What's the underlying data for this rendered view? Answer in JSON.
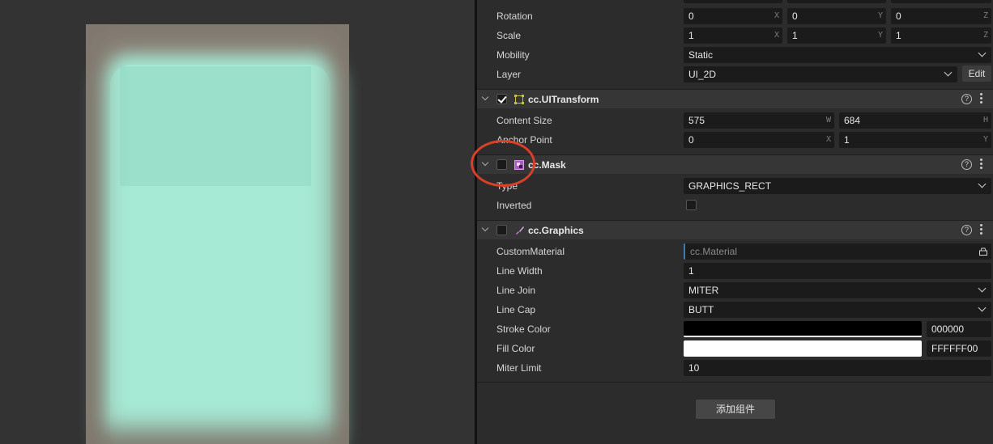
{
  "transform": {
    "rotation": {
      "label": "Rotation",
      "x": "0",
      "y": "0",
      "z": "0"
    },
    "scale": {
      "label": "Scale",
      "x": "1",
      "y": "1",
      "z": "1"
    },
    "mobility": {
      "label": "Mobility",
      "value": "Static"
    },
    "layer": {
      "label": "Layer",
      "value": "UI_2D",
      "edit_label": "Edit"
    }
  },
  "axis_labels": {
    "x": "X",
    "y": "Y",
    "z": "Z",
    "w": "W",
    "h": "H"
  },
  "ui_transform": {
    "title": "cc.UITransform",
    "content_size": {
      "label": "Content Size",
      "w": "575",
      "h": "684"
    },
    "anchor_point": {
      "label": "Anchor Point",
      "x": "0",
      "y": "1"
    }
  },
  "mask": {
    "title": "cc.Mask",
    "type": {
      "label": "Type",
      "value": "GRAPHICS_RECT"
    },
    "inverted": {
      "label": "Inverted"
    }
  },
  "graphics": {
    "title": "cc.Graphics",
    "custom_material": {
      "label": "CustomMaterial",
      "placeholder": "cc.Material"
    },
    "line_width": {
      "label": "Line Width",
      "value": "1"
    },
    "line_join": {
      "label": "Line Join",
      "value": "MITER"
    },
    "line_cap": {
      "label": "Line Cap",
      "value": "BUTT"
    },
    "stroke_color": {
      "label": "Stroke Color",
      "hex": "000000",
      "color": "#000000"
    },
    "fill_color": {
      "label": "Fill Color",
      "hex": "FFFFFF00",
      "color": "#ffffff"
    },
    "miter_limit": {
      "label": "Miter Limit",
      "value": "10"
    }
  },
  "add_component_label": "添加组件",
  "colors": {
    "highlight": "#d8402a",
    "preview_fill": "#a6e9d4"
  }
}
